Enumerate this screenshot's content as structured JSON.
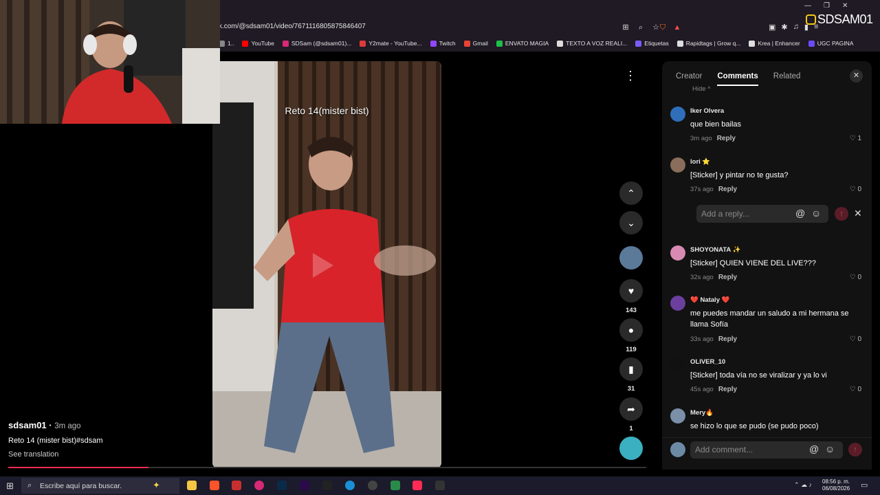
{
  "browser": {
    "url": "k.com/@sdsam01/video/7671116805875846407",
    "bookmarks": [
      "1..",
      "YouTube",
      "SDSam (@sdsam01)...",
      "Y2mate - YouTube...",
      "Twitch",
      "Gmail",
      "ENVATO MAGIA",
      "TEXTO A VOZ REALI...",
      "Etiquetas",
      "Rapidtags | Grow q...",
      "Krea | Enhancer",
      "UGC PAGINA"
    ],
    "bookmark_colors": [
      "#888888",
      "#ff0000",
      "#d62976",
      "#e03a3a",
      "#9146ff",
      "#ea4335",
      "#1fbf4a",
      "#dddddd",
      "#7a5cff",
      "#dddddd",
      "#dddddd",
      "#6a4cff"
    ]
  },
  "overlay": {
    "logo_text": "SDSAM01"
  },
  "video": {
    "title_overlay": "Reto 14(mister bist)",
    "author": "sdsam01",
    "time": "3m ago",
    "description": "Reto 14 (mister bist)#sdsam",
    "see_translation": "See translation",
    "progress": 0.22
  },
  "actions": {
    "likes": "143",
    "comments": "119",
    "saves": "31",
    "shares": "1"
  },
  "panel": {
    "tabs": [
      "Creator",
      "Comments",
      "Related"
    ],
    "active_tab": "Comments",
    "hide_label": "Hide ^",
    "reply_placeholder": "Add a reply...",
    "comment_placeholder": "Add comment...",
    "comments": [
      {
        "user": "Iker Olvera",
        "text": "que bien bailas",
        "time": "3m ago",
        "reply": "Reply",
        "likes": "1",
        "avatar_color": "#2f6fba"
      },
      {
        "user": "lori ⭐",
        "text": "[Sticker] y pintar no te gusta?",
        "time": "37s ago",
        "reply": "Reply",
        "likes": "0",
        "avatar_color": "#8a6d5a"
      },
      {
        "user": "SHOYONATA ✨",
        "text": "[Sticker] QUIEN VIENE DEL LIVE???",
        "time": "32s ago",
        "reply": "Reply",
        "likes": "0",
        "avatar_color": "#d88ab2"
      },
      {
        "user": "❤️ Nataly ❤️",
        "text": "me puedes mandar un saludo a mi hermana se llama Sofía",
        "time": "33s ago",
        "reply": "Reply",
        "likes": "0",
        "avatar_color": "#6a3f9e"
      },
      {
        "user": "OLIVER_10",
        "text": "[Sticker] toda vía no se viralizar y ya lo vi",
        "time": "45s ago",
        "reply": "Reply",
        "likes": "0",
        "avatar_color": "#111111"
      },
      {
        "user": "Mery🔥",
        "text": "se hizo lo que se pudo (se pudo poco)",
        "time": "",
        "reply": "",
        "likes": "",
        "avatar_color": "#7a8fa8"
      }
    ]
  },
  "taskbar": {
    "search_placeholder": "Escribe aquí para buscar.",
    "time": "08:56 p. m.",
    "date": "06/08/2026"
  }
}
